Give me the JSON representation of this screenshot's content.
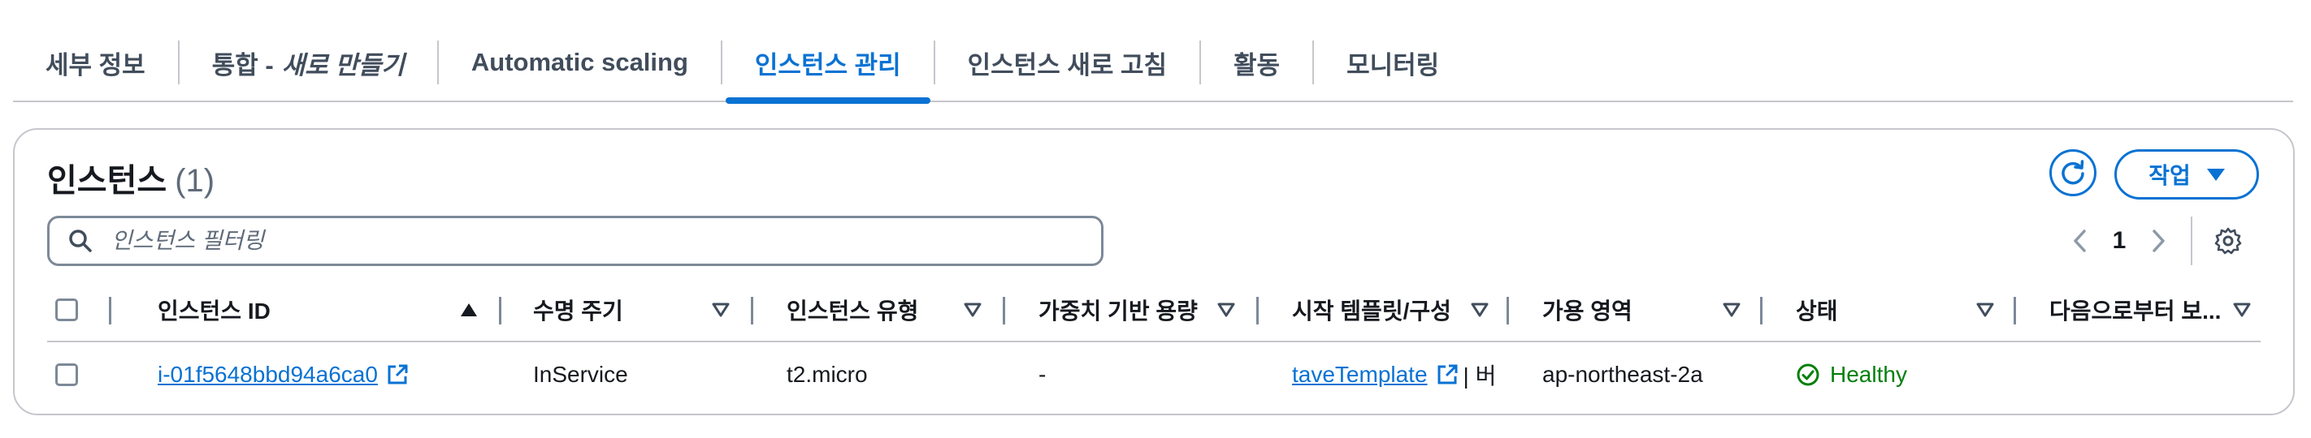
{
  "tabs": [
    {
      "label": "세부 정보"
    },
    {
      "label": "통합 -",
      "emph": "새로 만들기"
    },
    {
      "label": "Automatic scaling"
    },
    {
      "label": "인스턴스 관리"
    },
    {
      "label": "인스턴스 새로 고침"
    },
    {
      "label": "활동"
    },
    {
      "label": "모니터링"
    }
  ],
  "active_tab_index": 3,
  "panel": {
    "title": "인스턴스",
    "count": "(1)",
    "action_label": "작업",
    "filter_placeholder": "인스턴스 필터링",
    "page_number": "1"
  },
  "table": {
    "columns": [
      {
        "label": "인스턴스 ID",
        "sort": "ascending"
      },
      {
        "label": "수명 주기"
      },
      {
        "label": "인스턴스 유형"
      },
      {
        "label": "가중치 기반 용량"
      },
      {
        "label": "시작 템플릿/구성"
      },
      {
        "label": "가용 영역"
      },
      {
        "label": "상태"
      },
      {
        "label": "다음으로부터 보..."
      }
    ],
    "rows": [
      {
        "instance_id": "i-01f5648bbd94a6ca0",
        "lifecycle": "InService",
        "instance_type": "t2.micro",
        "weighted_capacity": "-",
        "launch_template": "taveTemplate",
        "launch_template_suffix": "| 버",
        "availability_zone": "ap-northeast-2a",
        "status": "Healthy"
      }
    ]
  },
  "colors": {
    "accent": "#0972d3",
    "success": "#037f0c",
    "border": "#c6c6cd"
  },
  "icons": [
    "search-icon",
    "refresh-icon",
    "caret-down-icon",
    "chevron-left-icon",
    "chevron-right-icon",
    "gear-icon",
    "sort-ascending-icon",
    "sort-icon",
    "external-link-icon",
    "check-circle-icon"
  ]
}
